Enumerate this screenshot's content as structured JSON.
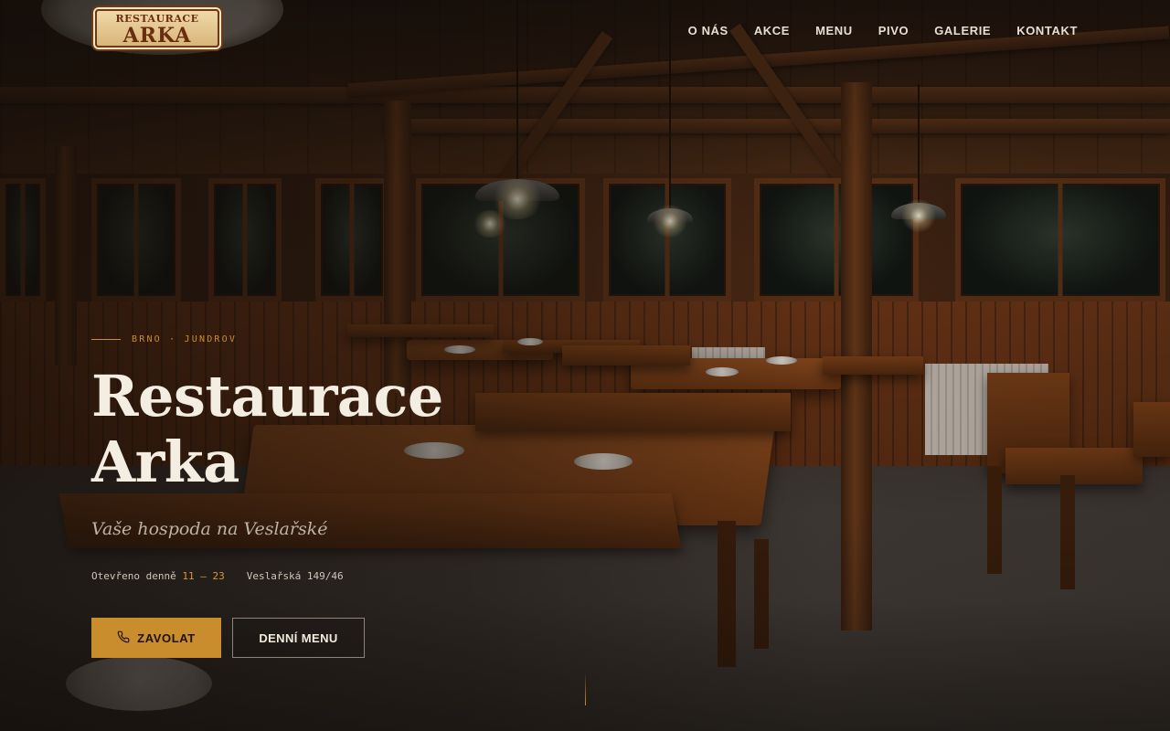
{
  "brand": {
    "logo_line1": "RESTAURACE",
    "logo_line2": "ARKA"
  },
  "nav": {
    "items": [
      {
        "label": "O NÁS"
      },
      {
        "label": "AKCE"
      },
      {
        "label": "MENU"
      },
      {
        "label": "PIVO"
      },
      {
        "label": "GALERIE"
      },
      {
        "label": "KONTAKT"
      }
    ]
  },
  "hero": {
    "eyebrow": "BRNO · JUNDROV",
    "title_line1": "Restaurace",
    "title_line2": "Arka",
    "subtitle": "Vaše hospoda na Veslařské",
    "hours_label": "Otevřeno denně",
    "hours_value": "11 – 23",
    "address": "Veslařská 149/46",
    "call_button": "ZAVOLAT",
    "call_icon": "phone-icon",
    "menu_button": "DENNÍ MENU"
  },
  "colors": {
    "accent": "#c98d2e",
    "text": "#f3ede2",
    "muted": "#bcb3a6"
  }
}
